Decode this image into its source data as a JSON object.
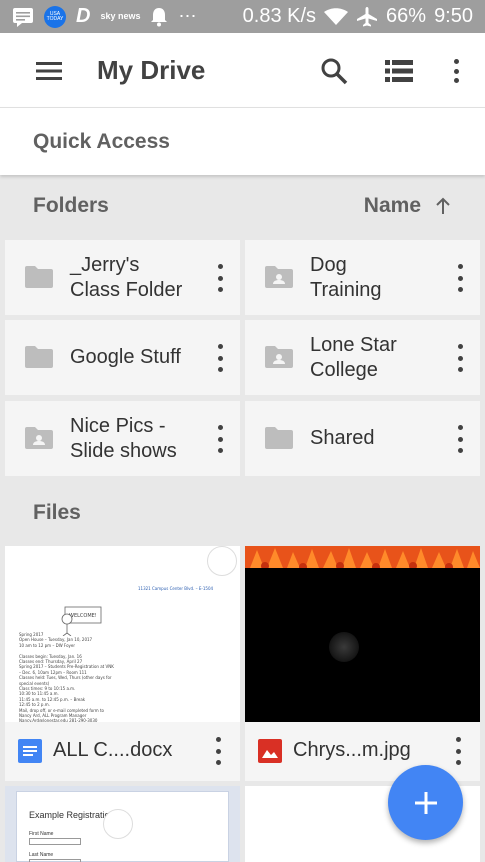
{
  "status_bar": {
    "network_speed": "0.83 K/s",
    "battery": "66%",
    "time": "9:50",
    "usa_today": "USA TODAY",
    "sky_news": "sky news"
  },
  "app_bar": {
    "title": "My Drive"
  },
  "quick_access": {
    "label": "Quick Access"
  },
  "folders_section": {
    "label": "Folders",
    "sort_label": "Name"
  },
  "folders": [
    {
      "line1": "_Jerry's",
      "line2": "Class Folder",
      "shared": false
    },
    {
      "line1": "Dog",
      "line2": "Training",
      "shared": true
    },
    {
      "line1": "Google Stuff",
      "line2": "",
      "shared": false
    },
    {
      "line1": "Lone Star",
      "line2": "College",
      "shared": true
    },
    {
      "line1": "Nice Pics -",
      "line2": "Slide shows",
      "shared": true
    },
    {
      "line1": "Shared",
      "line2": "",
      "shared": false
    }
  ],
  "files_section": {
    "label": "Files"
  },
  "files": [
    {
      "name": "ALL C....docx",
      "type": "doc",
      "preview": {
        "header": "11321 Campus Center Blvd. – E-1504",
        "lines": [
          "Spring 2017",
          "Open House – Tuesday, Jan 10, 2017",
          "10 am to 12 pm – DW Foyer",
          "",
          "Classes begin: Tuesday, Jan. 16",
          "Classes end: Thursday, April 27",
          "Spring 2017 – Students Pre-Registration at VNK",
          "  – Dec. 6, 10am 12pm – Room 111",
          "Classes held: Tues, Wed, Thurs (other days for",
          "special events)",
          "Class times: 9 to 10:15 a.m.",
          "   10:30 to 11:45 a.m.",
          "   11:45 a.m. to 12:45 p.m. – Break",
          "   12:45 to 2 p.m.",
          "Mail, drop off, or e-mail completed form to",
          "Nancy Ard, ALL Program Manager",
          "Nancy.Ard@lonestar.edu  281-290-3030"
        ]
      }
    },
    {
      "name": "Chrys...m.jpg",
      "type": "image"
    },
    {
      "name": "",
      "type": "doc",
      "preview": {
        "title": "Example Registration",
        "field1": "First Name",
        "field2": "Last Name"
      }
    },
    {
      "name": "",
      "type": "blank"
    }
  ],
  "colors": {
    "status_bar": "#9e9e9e",
    "fab": "#4285f4",
    "doc_icon": "#4285f4",
    "image_icon": "#d93025",
    "folder_icon": "#bdbdbd"
  },
  "icons": [
    "menu-icon",
    "search-icon",
    "list-view-icon",
    "more-vert-icon",
    "arrow-up-icon",
    "folder-icon",
    "shared-folder-icon",
    "docs-icon",
    "image-icon",
    "add-icon"
  ]
}
